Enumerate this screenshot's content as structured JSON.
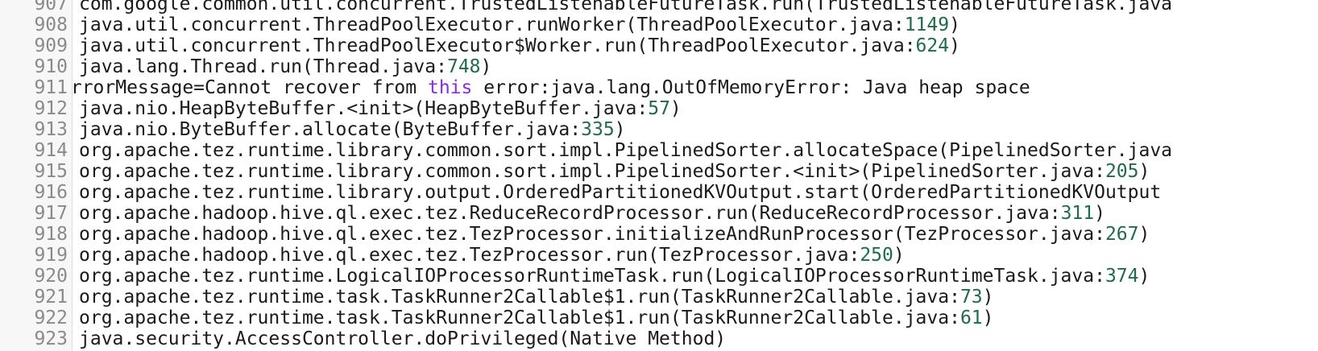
{
  "lines": [
    {
      "number": "907",
      "segments": [
        {
          "text": "com.google.common.util.concurrent.TrustedListenableFutureTask.run(TrustedListenableFutureTask.java",
          "type": "plain"
        }
      ]
    },
    {
      "number": "908",
      "segments": [
        {
          "text": "java.util.concurrent.ThreadPoolExecutor.runWorker(ThreadPoolExecutor.java:",
          "type": "plain"
        },
        {
          "text": "1149",
          "type": "num"
        },
        {
          "text": ")",
          "type": "plain"
        }
      ]
    },
    {
      "number": "909",
      "segments": [
        {
          "text": "java.util.concurrent.ThreadPoolExecutor$Worker.run(ThreadPoolExecutor.java:",
          "type": "plain"
        },
        {
          "text": "624",
          "type": "num"
        },
        {
          "text": ")",
          "type": "plain"
        }
      ]
    },
    {
      "number": "910",
      "segments": [
        {
          "text": "java.lang.Thread.run(Thread.java:",
          "type": "plain"
        },
        {
          "text": "748",
          "type": "num"
        },
        {
          "text": ")",
          "type": "plain"
        }
      ]
    },
    {
      "number": "911",
      "shifted": true,
      "segments": [
        {
          "text": "ErrorMessage=Cannot recover from ",
          "type": "plain"
        },
        {
          "text": "this",
          "type": "kw"
        },
        {
          "text": " error:java.lang.OutOfMemoryError: Java heap space",
          "type": "plain"
        }
      ]
    },
    {
      "number": "912",
      "segments": [
        {
          "text": "java.nio.HeapByteBuffer.<init>(HeapByteBuffer.java:",
          "type": "plain"
        },
        {
          "text": "57",
          "type": "num"
        },
        {
          "text": ")",
          "type": "plain"
        }
      ]
    },
    {
      "number": "913",
      "segments": [
        {
          "text": "java.nio.ByteBuffer.allocate(ByteBuffer.java:",
          "type": "plain"
        },
        {
          "text": "335",
          "type": "num"
        },
        {
          "text": ")",
          "type": "plain"
        }
      ]
    },
    {
      "number": "914",
      "segments": [
        {
          "text": "org.apache.tez.runtime.library.common.sort.impl.PipelinedSorter.allocateSpace(PipelinedSorter.java",
          "type": "plain"
        }
      ]
    },
    {
      "number": "915",
      "segments": [
        {
          "text": "org.apache.tez.runtime.library.common.sort.impl.PipelinedSorter.<init>(PipelinedSorter.java:",
          "type": "plain"
        },
        {
          "text": "205",
          "type": "num"
        },
        {
          "text": ")",
          "type": "plain"
        }
      ]
    },
    {
      "number": "916",
      "segments": [
        {
          "text": "org.apache.tez.runtime.library.output.OrderedPartitionedKVOutput.start(OrderedPartitionedKVOutput",
          "type": "plain"
        }
      ]
    },
    {
      "number": "917",
      "segments": [
        {
          "text": "org.apache.hadoop.hive.ql.exec.tez.ReduceRecordProcessor.run(ReduceRecordProcessor.java:",
          "type": "plain"
        },
        {
          "text": "311",
          "type": "num"
        },
        {
          "text": ")",
          "type": "plain"
        }
      ]
    },
    {
      "number": "918",
      "segments": [
        {
          "text": "org.apache.hadoop.hive.ql.exec.tez.TezProcessor.initializeAndRunProcessor(TezProcessor.java:",
          "type": "plain"
        },
        {
          "text": "267",
          "type": "num"
        },
        {
          "text": ")",
          "type": "plain"
        }
      ]
    },
    {
      "number": "919",
      "segments": [
        {
          "text": "org.apache.hadoop.hive.ql.exec.tez.TezProcessor.run(TezProcessor.java:",
          "type": "plain"
        },
        {
          "text": "250",
          "type": "num"
        },
        {
          "text": ")",
          "type": "plain"
        }
      ]
    },
    {
      "number": "920",
      "segments": [
        {
          "text": "org.apache.tez.runtime.LogicalIOProcessorRuntimeTask.run(LogicalIOProcessorRuntimeTask.java:",
          "type": "plain"
        },
        {
          "text": "374",
          "type": "num"
        },
        {
          "text": ")",
          "type": "plain"
        }
      ]
    },
    {
      "number": "921",
      "segments": [
        {
          "text": "org.apache.tez.runtime.task.TaskRunner2Callable$1.run(TaskRunner2Callable.java:",
          "type": "plain"
        },
        {
          "text": "73",
          "type": "num"
        },
        {
          "text": ")",
          "type": "plain"
        }
      ]
    },
    {
      "number": "922",
      "segments": [
        {
          "text": "org.apache.tez.runtime.task.TaskRunner2Callable$1.run(TaskRunner2Callable.java:",
          "type": "plain"
        },
        {
          "text": "61",
          "type": "num"
        },
        {
          "text": ")",
          "type": "plain"
        }
      ]
    },
    {
      "number": "923",
      "segments": [
        {
          "text": "java.security.AccessController.doPrivileged(Native Method)",
          "type": "plain"
        }
      ]
    }
  ],
  "colors": {
    "line_number": "#8a8a8a",
    "number_literal": "#1f6b4a",
    "keyword": "#8a2be2",
    "text": "#1a1a1a",
    "gutter_bg": "#f7f7f7"
  }
}
